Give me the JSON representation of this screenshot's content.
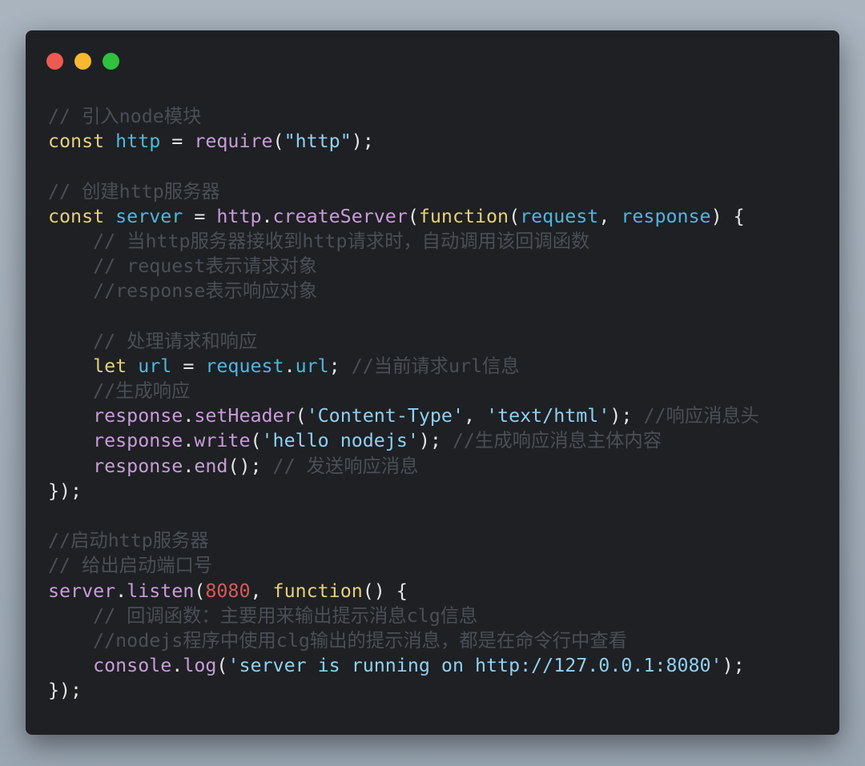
{
  "window": {
    "controls": [
      {
        "name": "close",
        "color": "#ee5a52"
      },
      {
        "name": "minimize",
        "color": "#f5b82e"
      },
      {
        "name": "maximize",
        "color": "#2fc23e"
      }
    ]
  },
  "colors": {
    "background": "#1e2023",
    "comment": "#4a4f57",
    "keyword": "#e5d07a",
    "function": "#c99bd9",
    "variable": "#4fb6df",
    "string": "#8fd0f2",
    "number": "#d55a5a",
    "punct": "#e6e6e6"
  },
  "code": {
    "lines": [
      [
        {
          "t": "comment",
          "v": "// 引入node模块"
        }
      ],
      [
        {
          "t": "keyword",
          "v": "const "
        },
        {
          "t": "variable",
          "v": "http"
        },
        {
          "t": "punct",
          "v": " = "
        },
        {
          "t": "function",
          "v": "require"
        },
        {
          "t": "punct",
          "v": "("
        },
        {
          "t": "string",
          "v": "\"http\""
        },
        {
          "t": "punct",
          "v": ");"
        }
      ],
      [],
      [
        {
          "t": "comment",
          "v": "// 创建http服务器"
        }
      ],
      [
        {
          "t": "keyword",
          "v": "const "
        },
        {
          "t": "variable",
          "v": "server"
        },
        {
          "t": "punct",
          "v": " = "
        },
        {
          "t": "function",
          "v": "http"
        },
        {
          "t": "punct",
          "v": "."
        },
        {
          "t": "function",
          "v": "createServer"
        },
        {
          "t": "punct",
          "v": "("
        },
        {
          "t": "keyword",
          "v": "function"
        },
        {
          "t": "punct",
          "v": "("
        },
        {
          "t": "variable",
          "v": "request"
        },
        {
          "t": "punct",
          "v": ", "
        },
        {
          "t": "variable",
          "v": "response"
        },
        {
          "t": "punct",
          "v": ") {"
        }
      ],
      [
        {
          "t": "punct",
          "v": "    "
        },
        {
          "t": "comment",
          "v": "// 当http服务器接收到http请求时，自动调用该回调函数"
        }
      ],
      [
        {
          "t": "punct",
          "v": "    "
        },
        {
          "t": "comment",
          "v": "// request表示请求对象"
        }
      ],
      [
        {
          "t": "punct",
          "v": "    "
        },
        {
          "t": "comment",
          "v": "//response表示响应对象"
        }
      ],
      [],
      [
        {
          "t": "punct",
          "v": "    "
        },
        {
          "t": "comment",
          "v": "// 处理请求和响应"
        }
      ],
      [
        {
          "t": "punct",
          "v": "    "
        },
        {
          "t": "keyword",
          "v": "let "
        },
        {
          "t": "variable",
          "v": "url"
        },
        {
          "t": "punct",
          "v": " = "
        },
        {
          "t": "variable",
          "v": "request"
        },
        {
          "t": "punct",
          "v": "."
        },
        {
          "t": "variable",
          "v": "url"
        },
        {
          "t": "punct",
          "v": "; "
        },
        {
          "t": "comment",
          "v": "//当前请求url信息"
        }
      ],
      [
        {
          "t": "punct",
          "v": "    "
        },
        {
          "t": "comment",
          "v": "//生成响应"
        }
      ],
      [
        {
          "t": "punct",
          "v": "    "
        },
        {
          "t": "function",
          "v": "response"
        },
        {
          "t": "punct",
          "v": "."
        },
        {
          "t": "function",
          "v": "setHeader"
        },
        {
          "t": "punct",
          "v": "("
        },
        {
          "t": "string",
          "v": "'Content-Type'"
        },
        {
          "t": "punct",
          "v": ", "
        },
        {
          "t": "string",
          "v": "'text/html'"
        },
        {
          "t": "punct",
          "v": "); "
        },
        {
          "t": "comment",
          "v": "//响应消息头"
        }
      ],
      [
        {
          "t": "punct",
          "v": "    "
        },
        {
          "t": "function",
          "v": "response"
        },
        {
          "t": "punct",
          "v": "."
        },
        {
          "t": "function",
          "v": "write"
        },
        {
          "t": "punct",
          "v": "("
        },
        {
          "t": "string",
          "v": "'hello nodejs'"
        },
        {
          "t": "punct",
          "v": "); "
        },
        {
          "t": "comment",
          "v": "//生成响应消息主体内容"
        }
      ],
      [
        {
          "t": "punct",
          "v": "    "
        },
        {
          "t": "function",
          "v": "response"
        },
        {
          "t": "punct",
          "v": "."
        },
        {
          "t": "function",
          "v": "end"
        },
        {
          "t": "punct",
          "v": "(); "
        },
        {
          "t": "comment",
          "v": "// 发送响应消息"
        }
      ],
      [
        {
          "t": "punct",
          "v": "});"
        }
      ],
      [],
      [
        {
          "t": "comment",
          "v": "//启动http服务器"
        }
      ],
      [
        {
          "t": "comment",
          "v": "// 给出启动端口号"
        }
      ],
      [
        {
          "t": "function",
          "v": "server"
        },
        {
          "t": "punct",
          "v": "."
        },
        {
          "t": "function",
          "v": "listen"
        },
        {
          "t": "punct",
          "v": "("
        },
        {
          "t": "number",
          "v": "8080"
        },
        {
          "t": "punct",
          "v": ", "
        },
        {
          "t": "keyword",
          "v": "function"
        },
        {
          "t": "punct",
          "v": "() {"
        }
      ],
      [
        {
          "t": "punct",
          "v": "    "
        },
        {
          "t": "comment",
          "v": "// 回调函数：主要用来输出提示消息clg信息"
        }
      ],
      [
        {
          "t": "punct",
          "v": "    "
        },
        {
          "t": "comment",
          "v": "//nodejs程序中使用clg输出的提示消息，都是在命令行中查看"
        }
      ],
      [
        {
          "t": "punct",
          "v": "    "
        },
        {
          "t": "function",
          "v": "console"
        },
        {
          "t": "punct",
          "v": "."
        },
        {
          "t": "function",
          "v": "log"
        },
        {
          "t": "punct",
          "v": "("
        },
        {
          "t": "string",
          "v": "'server is running on http://127.0.0.1:8080'"
        },
        {
          "t": "punct",
          "v": ");"
        }
      ],
      [
        {
          "t": "punct",
          "v": "});"
        }
      ]
    ]
  }
}
